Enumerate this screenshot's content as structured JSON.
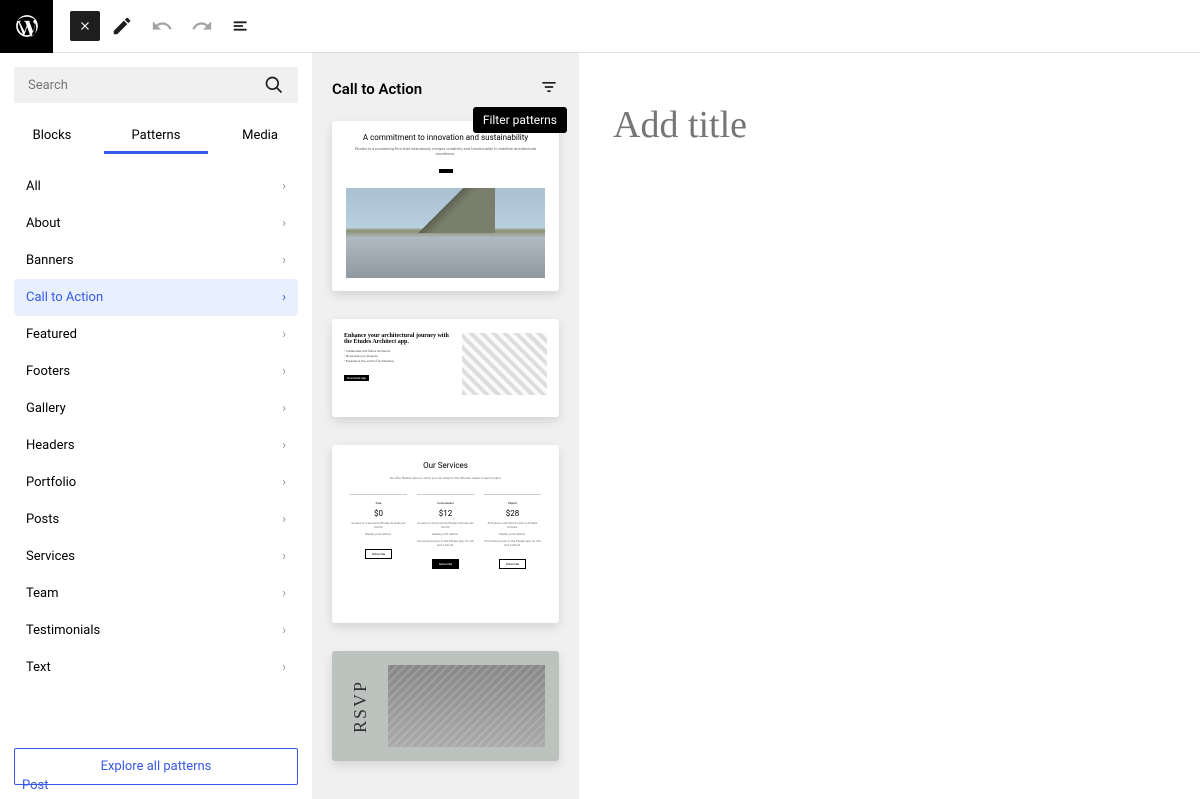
{
  "search": {
    "placeholder": "Search"
  },
  "tabs": {
    "blocks": "Blocks",
    "patterns": "Patterns",
    "media": "Media"
  },
  "categories": [
    {
      "label": "All"
    },
    {
      "label": "About"
    },
    {
      "label": "Banners"
    },
    {
      "label": "Call to Action",
      "active": true
    },
    {
      "label": "Featured"
    },
    {
      "label": "Footers"
    },
    {
      "label": "Gallery"
    },
    {
      "label": "Headers"
    },
    {
      "label": "Portfolio"
    },
    {
      "label": "Posts"
    },
    {
      "label": "Services"
    },
    {
      "label": "Team"
    },
    {
      "label": "Testimonials"
    },
    {
      "label": "Text"
    }
  ],
  "exploreBtn": "Explore all patterns",
  "footerLink": "Post",
  "panelTitle": "Call to Action",
  "tooltip": "Filter patterns",
  "canvas": {
    "titlePlaceholder": "Add title"
  },
  "p1": {
    "title": "A commitment to innovation and sustainability",
    "desc": "Études is a pioneering firm that seamlessly merges creativity and functionality to redefine architectural excellence."
  },
  "p2": {
    "title": "Enhance your architectural journey with the Études Architect app.",
    "li1": "• Collaborate with fellow architects.",
    "li2": "• Showcase your projects.",
    "li3": "• Experience the world of architecture.",
    "btn": "Download app"
  },
  "p3": {
    "title": "Our Services",
    "sub": "We offer flexible options, which you can adapt to the different needs of each project.",
    "tiers": [
      {
        "name": "Free",
        "price": "$0",
        "d1": "Access to 5 exclusive Études Articles per month.",
        "d2": "Weekly print edition.",
        "d3": "",
        "btn": "Subscribe",
        "fill": false
      },
      {
        "name": "Connoisseur",
        "price": "$12",
        "d1": "Access to 20 exclusive Études Articles per month.",
        "d2": "Weekly print edition.",
        "d3": "Exclusive access to the Études app for iOS and Android.",
        "btn": "Subscribe",
        "fill": true
      },
      {
        "name": "Expert",
        "price": "$28",
        "d1": "Exclusive, unlimited access to Études Articles.",
        "d2": "Weekly print edition.",
        "d3": "Exclusive access to the Études app for iOS and Android.",
        "btn": "Subscribe",
        "fill": false
      }
    ]
  },
  "p4": {
    "rsvp": "RSVP"
  }
}
